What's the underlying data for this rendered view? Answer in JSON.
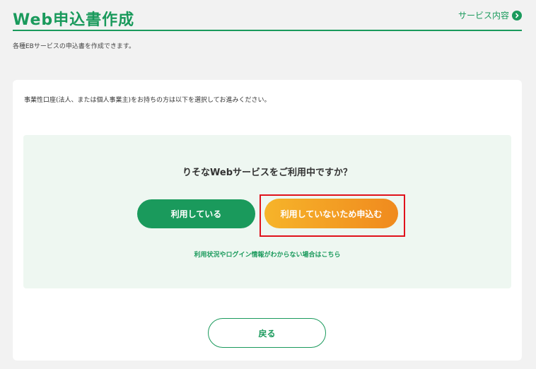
{
  "header": {
    "title": "Web申込書作成",
    "service_link": "サービス内容"
  },
  "subtitle": "各種EBサービスの申込書を作成できます。",
  "card": {
    "instruction": "事業性口座(法人、または個人事業主)をお持ちの方は以下を選択してお進みください。",
    "question": "りそなWebサービスをご利用中ですか？",
    "using_button": "利用している",
    "apply_button": "利用していないため申込む",
    "help_link": "利用状況やログイン情報がわからない場合はこちら",
    "back_button": "戻る"
  },
  "colors": {
    "brand_green": "#1a9a5c",
    "orange_start": "#f6b42a",
    "orange_end": "#f08a1e",
    "highlight_red": "#e0121c",
    "panel_bg": "#eef7f1"
  },
  "icons": {
    "service_link_icon": "chevron-right-circle-icon"
  }
}
